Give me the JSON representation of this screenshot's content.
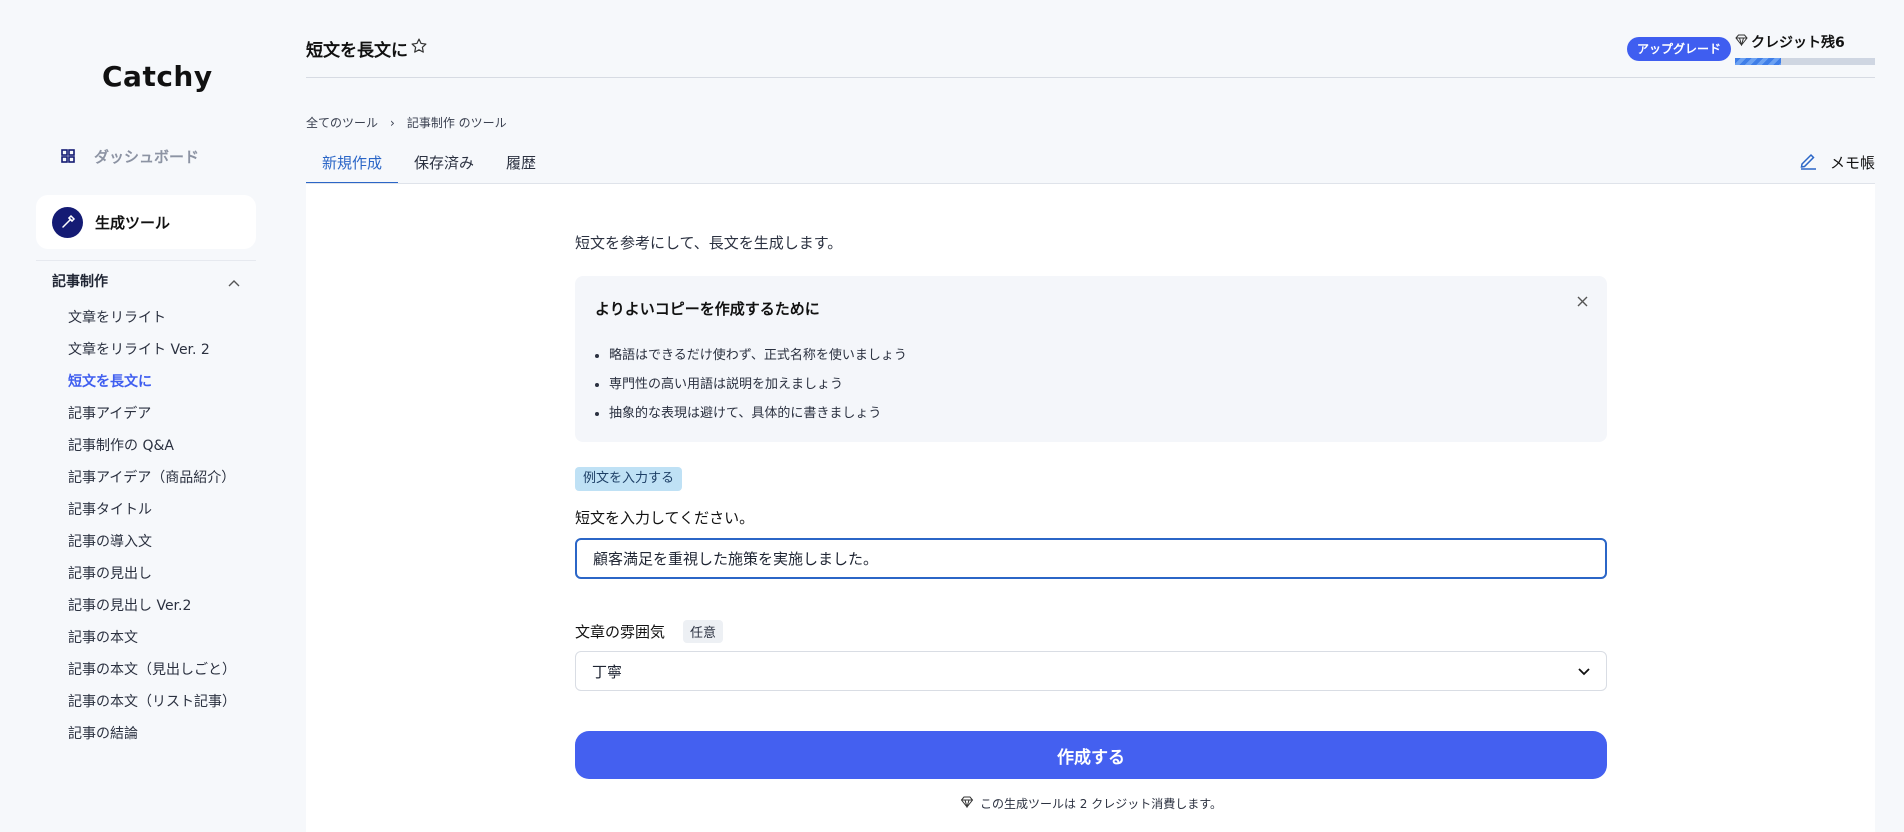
{
  "app": {
    "logo": "Catchy"
  },
  "sidebar": {
    "dashboard_label": "ダッシュボード",
    "tools_label": "生成ツール",
    "category_label": "記事制作",
    "items": [
      {
        "label": "文章をリライト"
      },
      {
        "label": "文章をリライト Ver. 2"
      },
      {
        "label": "短文を長文に"
      },
      {
        "label": "記事アイデア"
      },
      {
        "label": "記事制作の Q&A"
      },
      {
        "label": "記事アイデア（商品紹介）"
      },
      {
        "label": "記事タイトル"
      },
      {
        "label": "記事の導入文"
      },
      {
        "label": "記事の見出し"
      },
      {
        "label": "記事の見出し Ver.2"
      },
      {
        "label": "記事の本文"
      },
      {
        "label": "記事の本文（見出しごと）"
      },
      {
        "label": "記事の本文（リスト記事）"
      },
      {
        "label": "記事の結論"
      }
    ],
    "active_index": 2
  },
  "header": {
    "title": "短文を長文に",
    "upgrade_label": "アップグレード",
    "credit_label": "クレジット残6",
    "credit_fill_fraction": 0.33
  },
  "breadcrumb": {
    "root": "全てのツール",
    "sep": "›",
    "current": "記事制作 のツール"
  },
  "tabs": [
    {
      "label": "新規作成",
      "active": true
    },
    {
      "label": "保存済み",
      "active": false
    },
    {
      "label": "履歴",
      "active": false
    }
  ],
  "memo_label": "メモ帳",
  "main": {
    "intro": "短文を参考にして、長文を生成します。",
    "tips": {
      "title": "よりよいコピーを作成するために",
      "items": [
        "略語はできるだけ使わず、正式名称を使いましょう",
        "専門性の高い用語は説明を加えましょう",
        "抽象的な表現は避けて、具体的に書きましょう"
      ]
    },
    "example_button": "例文を入力する",
    "input_label": "短文を入力してください。",
    "input_value": "顧客満足を重視した施策を実施しました。",
    "mood_label": "文章の雰囲気",
    "mood_optional": "任意",
    "mood_value": "丁寧",
    "submit_label": "作成する",
    "consume_note": "この生成ツールは 2 クレジット消費します。"
  },
  "colors": {
    "accent": "#4460f0",
    "brand_dark": "#141b74",
    "tab_active": "#2b66c7"
  }
}
